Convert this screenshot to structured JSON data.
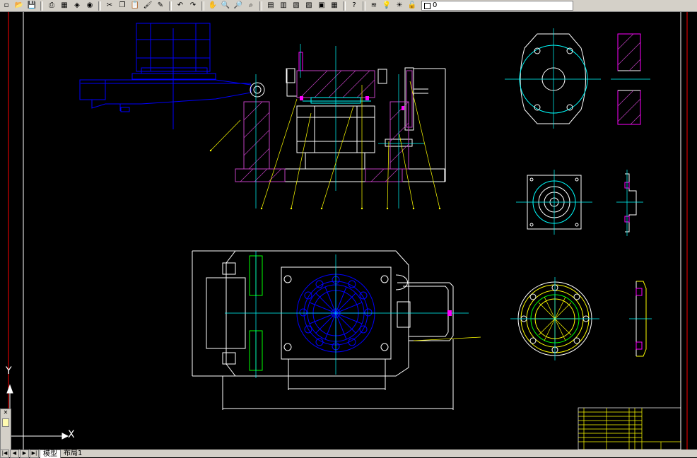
{
  "toolbar": {
    "buttons": [
      {
        "name": "new-icon",
        "glyph": "▫"
      },
      {
        "name": "open-icon",
        "glyph": "📂"
      },
      {
        "name": "save-icon",
        "glyph": "💾"
      },
      {
        "name": "plot-icon",
        "glyph": "⎙"
      },
      {
        "name": "preview-icon",
        "glyph": "▦"
      },
      {
        "name": "publish-icon",
        "glyph": "◈"
      },
      {
        "name": "plot-3d-icon",
        "glyph": "◉"
      },
      {
        "name": "cut-icon",
        "glyph": "✂"
      },
      {
        "name": "copy-icon",
        "glyph": "❐"
      },
      {
        "name": "paste-icon",
        "glyph": "📋"
      },
      {
        "name": "match-prop-icon",
        "glyph": "🖌"
      },
      {
        "name": "block-editor-icon",
        "glyph": "✎"
      },
      {
        "name": "undo-icon",
        "glyph": "↶"
      },
      {
        "name": "redo-icon",
        "glyph": "↷"
      },
      {
        "name": "pan-icon",
        "glyph": "✋"
      },
      {
        "name": "zoom-realtime-icon",
        "glyph": "🔍"
      },
      {
        "name": "zoom-window-icon",
        "glyph": "🔎"
      },
      {
        "name": "zoom-previous-icon",
        "glyph": "⌕"
      },
      {
        "name": "properties-icon",
        "glyph": "▤"
      },
      {
        "name": "design-center-icon",
        "glyph": "▥"
      },
      {
        "name": "tool-palette-icon",
        "glyph": "▧"
      },
      {
        "name": "sheet-set-icon",
        "glyph": "▨"
      },
      {
        "name": "markup-icon",
        "glyph": "▣"
      },
      {
        "name": "calculator-icon",
        "glyph": "▦"
      },
      {
        "name": "help-icon",
        "glyph": "?"
      }
    ],
    "layer_tools": [
      {
        "name": "layer-manager-icon",
        "glyph": "≋"
      },
      {
        "name": "bulb-icon",
        "glyph": "💡"
      },
      {
        "name": "sun-icon",
        "glyph": "☀"
      },
      {
        "name": "lock-icon",
        "glyph": "🔓"
      }
    ],
    "layer_value": "0"
  },
  "axis_labels": {
    "x": "X",
    "y": "Y"
  },
  "tabs": {
    "model": "模型",
    "layout1": "布局1"
  },
  "colors": {
    "background": "#000000",
    "magenta": "#ff00ff",
    "blue": "#0000ff",
    "cyan": "#00ffff",
    "yellow": "#ffff00",
    "white": "#ffffff",
    "green": "#00ff00",
    "red": "#ff0000"
  }
}
